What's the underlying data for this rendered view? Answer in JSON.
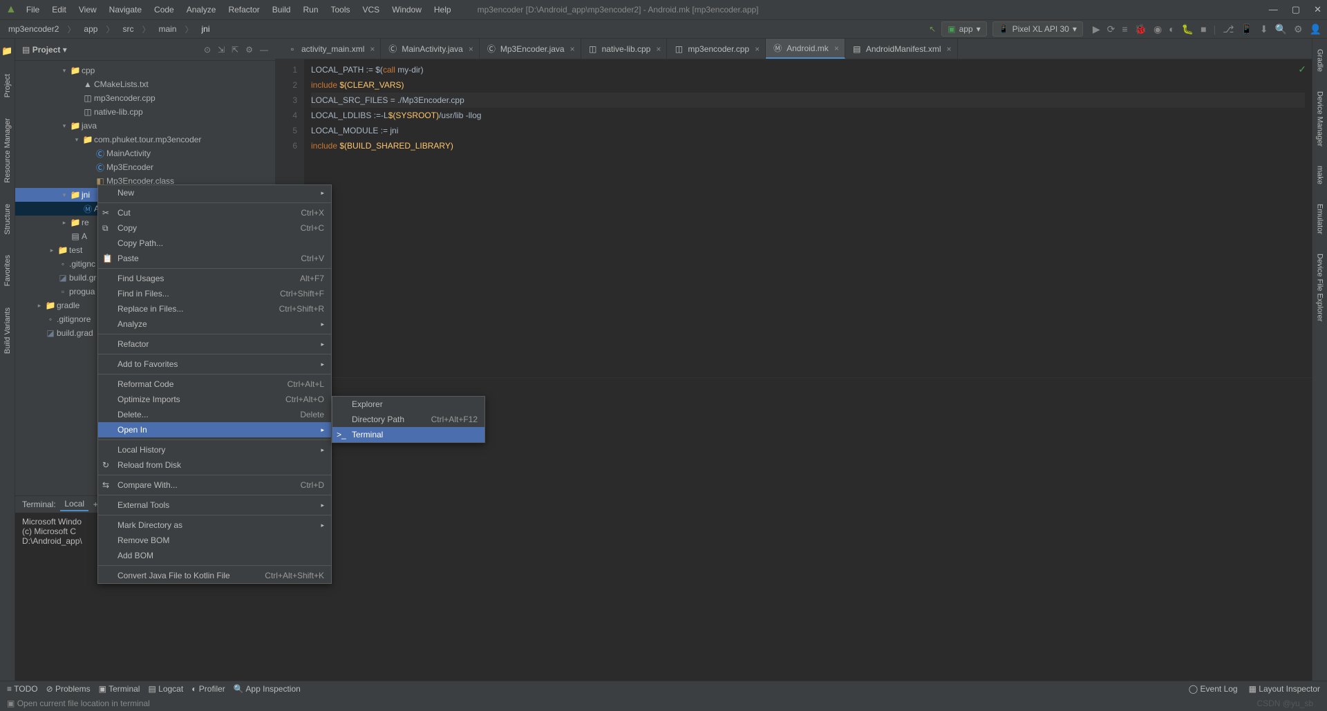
{
  "window": {
    "title": "mp3encoder [D:\\Android_app\\mp3encoder2] - Android.mk [mp3encoder.app]"
  },
  "menu": [
    "File",
    "Edit",
    "View",
    "Navigate",
    "Code",
    "Analyze",
    "Refactor",
    "Build",
    "Run",
    "Tools",
    "VCS",
    "Window",
    "Help"
  ],
  "breadcrumb": [
    "mp3encoder2",
    "app",
    "src",
    "main",
    "jni"
  ],
  "runConfig": {
    "app": "app",
    "device": "Pixel XL API 30"
  },
  "project": {
    "header": "Project",
    "tree": [
      {
        "indent": 3,
        "chev": "▾",
        "icon": "folder",
        "label": "cpp"
      },
      {
        "indent": 4,
        "icon": "cmake",
        "label": "CMakeLists.txt"
      },
      {
        "indent": 4,
        "icon": "cpp",
        "label": "mp3encoder.cpp"
      },
      {
        "indent": 4,
        "icon": "cpp",
        "label": "native-lib.cpp"
      },
      {
        "indent": 3,
        "chev": "▾",
        "icon": "folder",
        "label": "java"
      },
      {
        "indent": 4,
        "chev": "▾",
        "icon": "folder",
        "label": "com.phuket.tour.mp3encoder"
      },
      {
        "indent": 5,
        "icon": "java",
        "label": "MainActivity"
      },
      {
        "indent": 5,
        "icon": "java",
        "label": "Mp3Encoder"
      },
      {
        "indent": 5,
        "icon": "class",
        "label": "Mp3Encoder.class"
      },
      {
        "indent": 3,
        "chev": "▾",
        "icon": "folder",
        "label": "jni",
        "sel": true
      },
      {
        "indent": 4,
        "icon": "mk",
        "label": "A",
        "hl": true
      },
      {
        "indent": 3,
        "chev": "▸",
        "icon": "folder",
        "label": "re"
      },
      {
        "indent": 3,
        "icon": "mf",
        "label": "A"
      },
      {
        "indent": 2,
        "chev": "▸",
        "icon": "folder",
        "label": "test"
      },
      {
        "indent": 2,
        "icon": "gitignore",
        "label": ".gitignc"
      },
      {
        "indent": 2,
        "icon": "gradle",
        "label": "build.gr"
      },
      {
        "indent": 2,
        "icon": "file",
        "label": "progua"
      },
      {
        "indent": 1,
        "chev": "▸",
        "icon": "folder",
        "label": "gradle"
      },
      {
        "indent": 1,
        "icon": "gitignore",
        "label": ".gitignore"
      },
      {
        "indent": 1,
        "icon": "gradle",
        "label": "build.grad"
      }
    ]
  },
  "tabs": [
    {
      "icon": "xml",
      "label": "activity_main.xml"
    },
    {
      "icon": "java",
      "label": "MainActivity.java"
    },
    {
      "icon": "java",
      "label": "Mp3Encoder.java"
    },
    {
      "icon": "cpp",
      "label": "native-lib.cpp"
    },
    {
      "icon": "cpp",
      "label": "mp3encoder.cpp"
    },
    {
      "icon": "mk",
      "label": "Android.mk",
      "active": true
    },
    {
      "icon": "mf",
      "label": "AndroidManifest.xml"
    }
  ],
  "code": {
    "lines": [
      {
        "n": 1,
        "t": "LOCAL_PATH := $(call my-dir)"
      },
      {
        "n": 2,
        "t": "include $(CLEAR_VARS)"
      },
      {
        "n": 3,
        "t": "LOCAL_SRC_FILES = ./Mp3Encoder.cpp",
        "hl": true
      },
      {
        "n": 4,
        "t": "LOCAL_LDLIBS :=-L$(SYSROOT)/usr/lib -llog"
      },
      {
        "n": 5,
        "t": "LOCAL_MODULE := jni"
      },
      {
        "n": 6,
        "t": "include $(BUILD_SHARED_LIBRARY)"
      }
    ]
  },
  "terminal": {
    "title": "Terminal:",
    "tab": "Local",
    "lines": [
      "Microsoft Windo",
      "(c) Microsoft C",
      "D:\\Android_app\\"
    ]
  },
  "contextMenu": [
    {
      "label": "New",
      "arrow": true
    },
    {
      "sep": true
    },
    {
      "icon": "✂",
      "label": "Cut",
      "shortcut": "Ctrl+X"
    },
    {
      "icon": "⧉",
      "label": "Copy",
      "shortcut": "Ctrl+C"
    },
    {
      "label": "Copy Path..."
    },
    {
      "icon": "📋",
      "label": "Paste",
      "shortcut": "Ctrl+V"
    },
    {
      "sep": true
    },
    {
      "label": "Find Usages",
      "shortcut": "Alt+F7"
    },
    {
      "label": "Find in Files...",
      "shortcut": "Ctrl+Shift+F"
    },
    {
      "label": "Replace in Files...",
      "shortcut": "Ctrl+Shift+R"
    },
    {
      "label": "Analyze",
      "arrow": true
    },
    {
      "sep": true
    },
    {
      "label": "Refactor",
      "arrow": true
    },
    {
      "sep": true
    },
    {
      "label": "Add to Favorites",
      "arrow": true
    },
    {
      "sep": true
    },
    {
      "label": "Reformat Code",
      "shortcut": "Ctrl+Alt+L"
    },
    {
      "label": "Optimize Imports",
      "shortcut": "Ctrl+Alt+O"
    },
    {
      "label": "Delete...",
      "shortcut": "Delete"
    },
    {
      "label": "Open In",
      "arrow": true,
      "hl": true
    },
    {
      "sep": true
    },
    {
      "label": "Local History",
      "arrow": true
    },
    {
      "icon": "↻",
      "label": "Reload from Disk"
    },
    {
      "sep": true
    },
    {
      "icon": "⇆",
      "label": "Compare With...",
      "shortcut": "Ctrl+D"
    },
    {
      "sep": true
    },
    {
      "label": "External Tools",
      "arrow": true
    },
    {
      "sep": true
    },
    {
      "label": "Mark Directory as",
      "arrow": true
    },
    {
      "label": "Remove BOM"
    },
    {
      "label": "Add BOM"
    },
    {
      "sep": true
    },
    {
      "label": "Convert Java File to Kotlin File",
      "shortcut": "Ctrl+Alt+Shift+K"
    }
  ],
  "submenu": [
    {
      "label": "Explorer"
    },
    {
      "label": "Directory Path",
      "shortcut": "Ctrl+Alt+F12"
    },
    {
      "icon": ">_",
      "label": "Terminal",
      "hl": true
    }
  ],
  "bottomTabs": [
    "TODO",
    "Problems",
    "Terminal",
    "Logcat",
    "Profiler",
    "App Inspection"
  ],
  "statusRight": [
    "Event Log",
    "Layout Inspector"
  ],
  "statusText": "Open current file location in terminal",
  "watermark": "CSDN @yu_sb",
  "leftRailLabels": [
    "Project",
    "Resource Manager",
    "Structure",
    "Favorites",
    "Build Variants"
  ],
  "rightRailLabels": [
    "Gradle",
    "Device Manager",
    "make",
    "Emulator",
    "Device File Explorer"
  ]
}
